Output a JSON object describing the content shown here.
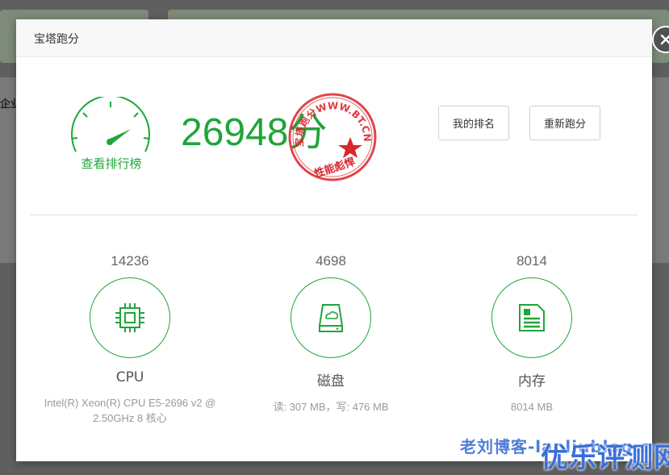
{
  "background": {
    "label": "企业"
  },
  "modal": {
    "title": "宝塔跑分",
    "total_score": "26948",
    "score_unit": "分",
    "rank_link": "查看排行榜",
    "buttons": {
      "my_rank": "我的排名",
      "rerun": "重新跑分"
    },
    "seal": {
      "ring_text": "宝塔跑分WWW.BT.CN",
      "bottom_text": "性能彪悍"
    }
  },
  "items": [
    {
      "score": "14236",
      "name": "CPU",
      "desc": "Intel(R) Xeon(R) CPU E5-2696 v2 @ 2.50GHz 8 核心",
      "icon": "cpu-chip-icon"
    },
    {
      "score": "4698",
      "name": "磁盘",
      "desc": "读: 307 MB，写: 476 MB",
      "icon": "disk-drive-icon"
    },
    {
      "score": "8014",
      "name": "内存",
      "desc": "8014 MB",
      "icon": "memory-icon"
    }
  ],
  "watermark": {
    "line1": "老刘博客-laoliublog.cn",
    "line2": "优乐评测网"
  },
  "colors": {
    "accent": "#20a53a",
    "seal_red": "#d9262c",
    "watermark_blue": "#3b6fd6"
  }
}
